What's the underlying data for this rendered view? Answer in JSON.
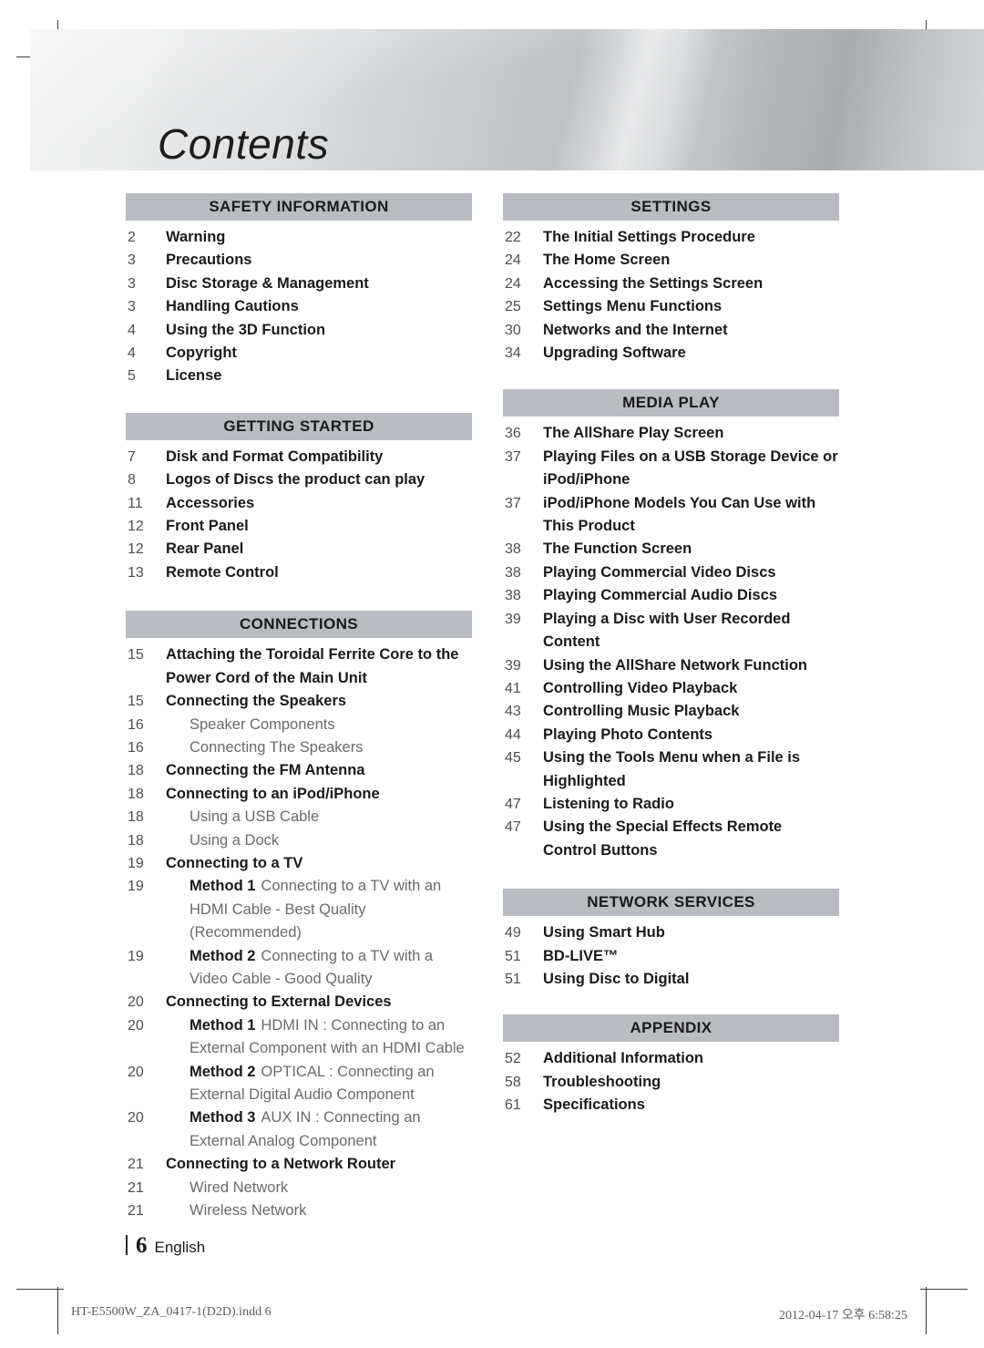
{
  "banner": {
    "title": "Contents"
  },
  "columns": {
    "left": [
      {
        "heading": "SAFETY INFORMATION",
        "entries": [
          {
            "page": "2",
            "level": 1,
            "text": "Warning"
          },
          {
            "page": "3",
            "level": 1,
            "text": "Precautions"
          },
          {
            "page": "3",
            "level": 1,
            "text": "Disc Storage & Management"
          },
          {
            "page": "3",
            "level": 1,
            "text": "Handling Cautions"
          },
          {
            "page": "4",
            "level": 1,
            "text": "Using the 3D Function"
          },
          {
            "page": "4",
            "level": 1,
            "text": "Copyright"
          },
          {
            "page": "5",
            "level": 1,
            "text": "License"
          }
        ]
      },
      {
        "heading": "GETTING STARTED",
        "entries": [
          {
            "page": "7",
            "level": 1,
            "text": "Disk and Format Compatibility"
          },
          {
            "page": "8",
            "level": 1,
            "text": "Logos of Discs the product can play"
          },
          {
            "page": "11",
            "level": 1,
            "text": "Accessories"
          },
          {
            "page": "12",
            "level": 1,
            "text": "Front Panel"
          },
          {
            "page": "12",
            "level": 1,
            "text": "Rear Panel"
          },
          {
            "page": "13",
            "level": 1,
            "text": "Remote Control"
          }
        ]
      },
      {
        "heading": "CONNECTIONS",
        "entries": [
          {
            "page": "15",
            "level": 1,
            "text": "Attaching the Toroidal Ferrite Core to the Power Cord of the Main Unit"
          },
          {
            "page": "15",
            "level": 1,
            "text": "Connecting the Speakers"
          },
          {
            "page": "16",
            "level": 2,
            "text": "Speaker Components"
          },
          {
            "page": "16",
            "level": 2,
            "text": "Connecting The Speakers"
          },
          {
            "page": "18",
            "level": 1,
            "text": "Connecting the FM Antenna"
          },
          {
            "page": "18",
            "level": 1,
            "text": "Connecting to an iPod/iPhone"
          },
          {
            "page": "18",
            "level": 2,
            "text": "Using a USB Cable"
          },
          {
            "page": "18",
            "level": 2,
            "text": "Using a Dock"
          },
          {
            "page": "19",
            "level": 1,
            "text": "Connecting to a TV"
          },
          {
            "page": "19",
            "level": 2,
            "label": "Method 1",
            "text": "Connecting to a TV with an HDMI Cable - Best Quality (Recommended)"
          },
          {
            "page": "19",
            "level": 2,
            "label": "Method 2",
            "text": "Connecting to a TV with a Video Cable - Good Quality"
          },
          {
            "page": "20",
            "level": 1,
            "text": "Connecting to External Devices"
          },
          {
            "page": "20",
            "level": 2,
            "label": "Method 1",
            "text": "HDMI IN : Connecting to an External Component with an HDMI Cable"
          },
          {
            "page": "20",
            "level": 2,
            "label": "Method 2",
            "text": "OPTICAL : Connecting an External Digital Audio Component"
          },
          {
            "page": "20",
            "level": 2,
            "label": "Method 3",
            "text": "AUX IN : Connecting an External Analog Component"
          },
          {
            "page": "21",
            "level": 1,
            "text": "Connecting to a Network Router"
          },
          {
            "page": "21",
            "level": 2,
            "text": "Wired Network"
          },
          {
            "page": "21",
            "level": 2,
            "text": "Wireless Network"
          }
        ]
      }
    ],
    "right": [
      {
        "heading": "SETTINGS",
        "entries": [
          {
            "page": "22",
            "level": 1,
            "text": "The Initial Settings Procedure"
          },
          {
            "page": "24",
            "level": 1,
            "text": "The Home Screen"
          },
          {
            "page": "24",
            "level": 1,
            "text": "Accessing the Settings Screen"
          },
          {
            "page": "25",
            "level": 1,
            "text": "Settings Menu Functions"
          },
          {
            "page": "30",
            "level": 1,
            "text": "Networks and the Internet"
          },
          {
            "page": "34",
            "level": 1,
            "text": "Upgrading Software"
          }
        ]
      },
      {
        "heading": "MEDIA PLAY",
        "entries": [
          {
            "page": "36",
            "level": 1,
            "text": "The AllShare Play Screen"
          },
          {
            "page": "37",
            "level": 1,
            "text": "Playing Files on a USB Storage Device or iPod/iPhone"
          },
          {
            "page": "37",
            "level": 1,
            "text": "iPod/iPhone Models You Can Use with This Product"
          },
          {
            "page": "38",
            "level": 1,
            "text": "The Function Screen"
          },
          {
            "page": "38",
            "level": 1,
            "text": "Playing Commercial Video Discs"
          },
          {
            "page": "38",
            "level": 1,
            "text": "Playing Commercial Audio Discs"
          },
          {
            "page": "39",
            "level": 1,
            "text": "Playing a Disc with User Recorded Content"
          },
          {
            "page": "39",
            "level": 1,
            "text": "Using the AllShare Network Function"
          },
          {
            "page": "41",
            "level": 1,
            "text": "Controlling Video Playback"
          },
          {
            "page": "43",
            "level": 1,
            "text": "Controlling Music Playback"
          },
          {
            "page": "44",
            "level": 1,
            "text": "Playing Photo Contents"
          },
          {
            "page": "45",
            "level": 1,
            "text": "Using the Tools Menu when a File is Highlighted"
          },
          {
            "page": "47",
            "level": 1,
            "text": "Listening to Radio"
          },
          {
            "page": "47",
            "level": 1,
            "text": "Using the Special Effects Remote Control Buttons"
          }
        ]
      },
      {
        "heading": "NETWORK SERVICES",
        "entries": [
          {
            "page": "49",
            "level": 1,
            "text": "Using Smart Hub"
          },
          {
            "page": "51",
            "level": 1,
            "text": "BD-LIVE™"
          },
          {
            "page": "51",
            "level": 1,
            "text": "Using Disc to Digital"
          }
        ]
      },
      {
        "heading": "APPENDIX",
        "entries": [
          {
            "page": "52",
            "level": 1,
            "text": "Additional Information"
          },
          {
            "page": "58",
            "level": 1,
            "text": "Troubleshooting"
          },
          {
            "page": "61",
            "level": 1,
            "text": "Specifications"
          }
        ]
      }
    ]
  },
  "footer": {
    "page_number": "6",
    "language": "English"
  },
  "print_info": {
    "file": "HT-E5500W_ZA_0417-1(D2D).indd   6",
    "timestamp": "2012-04-17   오후 6:58:25"
  },
  "colors": {
    "section_bar": "#b9bcc0",
    "heading_text": "#1a1a1a",
    "page_number": "#4e4e4e",
    "sub_entry_text": "#6a6a6a"
  }
}
